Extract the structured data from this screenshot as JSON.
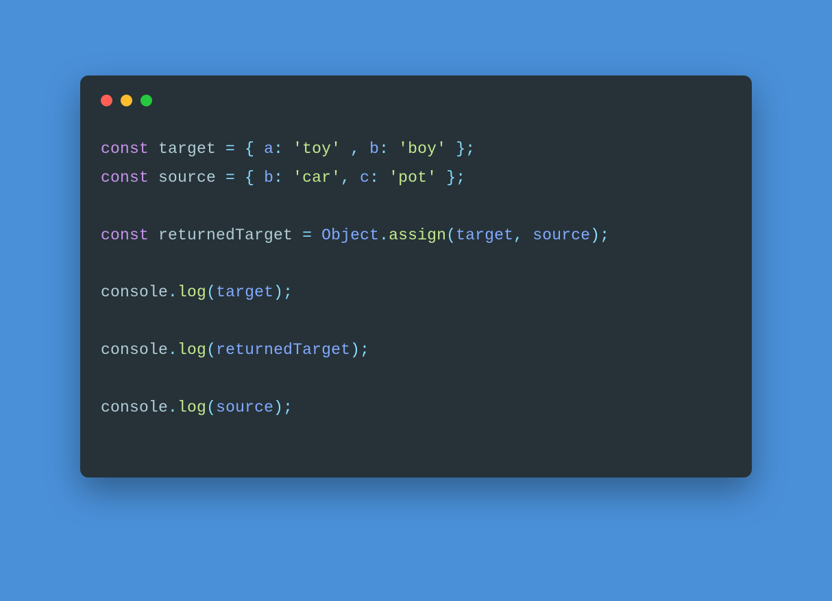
{
  "window_controls": {
    "close": "close",
    "minimize": "minimize",
    "zoom": "zoom"
  },
  "colors": {
    "background": "#4a90d9",
    "editor_bg": "#263238",
    "keyword": "#c792ea",
    "identifier": "#b2ccd6",
    "operator": "#89ddff",
    "property": "#82aaff",
    "string": "#c3e88d",
    "class": "#82aaff",
    "function": "#c3e88d",
    "traffic_red": "#ff5f56",
    "traffic_yellow": "#ffbd2e",
    "traffic_green": "#27c93f"
  },
  "code": {
    "l1_const": "const",
    "l1_v1": "target",
    "l1_eq": " = ",
    "l1_ob": "{ ",
    "l1_k1": "a",
    "l1_c1": ": ",
    "l1_s1": "'toy'",
    "l1_sep1": " , ",
    "l1_k2": "b",
    "l1_c2": ": ",
    "l1_s2": "'boy'",
    "l1_cb": " };",
    "l2_const": "const",
    "l2_v1": "source",
    "l2_eq": " = ",
    "l2_ob": "{ ",
    "l2_k1": "b",
    "l2_c1": ": ",
    "l2_s1": "'car'",
    "l2_sep1": ", ",
    "l2_k2": "c",
    "l2_c2": ": ",
    "l2_s2": "'pot'",
    "l2_cb": " };",
    "l4_const": "const",
    "l4_v1": "returnedTarget",
    "l4_eq": " = ",
    "l4_cls": "Object",
    "l4_dot": ".",
    "l4_fn": "assign",
    "l4_op": "(",
    "l4_a1": "target",
    "l4_sep": ", ",
    "l4_a2": "source",
    "l4_cp": ");",
    "l6_obj": "console",
    "l6_dot": ".",
    "l6_fn": "log",
    "l6_op": "(",
    "l6_a1": "target",
    "l6_cp": ");",
    "l8_obj": "console",
    "l8_dot": ".",
    "l8_fn": "log",
    "l8_op": "(",
    "l8_a1": "returnedTarget",
    "l8_cp": ");",
    "l10_obj": "console",
    "l10_dot": ".",
    "l10_fn": "log",
    "l10_op": "(",
    "l10_a1": "source",
    "l10_cp": ");",
    "sp": " ",
    "blank": ""
  }
}
